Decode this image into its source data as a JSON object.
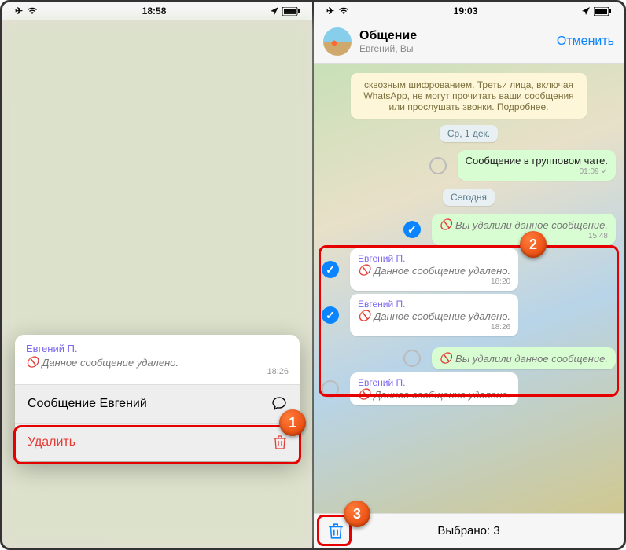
{
  "left": {
    "status": {
      "time": "18:58"
    },
    "bubble": {
      "sender": "Евгений П.",
      "text": "Данное сообщение удалено.",
      "time": "18:26"
    },
    "menu": {
      "reply": "Сообщение Евгений",
      "delete": "Удалить"
    },
    "badge": "1"
  },
  "right": {
    "status": {
      "time": "19:03"
    },
    "header": {
      "title": "Общение",
      "subtitle": "Евгений, Вы",
      "cancel": "Отменить"
    },
    "encryption_note": "сквозным шифрованием. Третьи лица, включая WhatsApp, не могут прочитать ваши сообщения или прослушать звонки. Подробнее.",
    "date1": "Ср, 1 дек.",
    "date2": "Сегодня",
    "msg_out1": {
      "text": "Сообщение в групповом чате.",
      "time": "01:09"
    },
    "sel": [
      {
        "sender": "",
        "text": "Вы удалили данное сообщение.",
        "time": "15:48",
        "out": true
      },
      {
        "sender": "Евгений П.",
        "text": "Данное сообщение удалено.",
        "time": "18:20",
        "out": false
      },
      {
        "sender": "Евгений П.",
        "text": "Данное сообщение удалено.",
        "time": "18:26",
        "out": false
      }
    ],
    "msg_out2": {
      "text": "Вы удалили данное сообщение.",
      "time": ""
    },
    "msg_in2": {
      "sender": "Евгений П.",
      "text": "Данное сообщение удалено.",
      "time": ""
    },
    "footer": "Выбрано: 3",
    "badge2": "2",
    "badge3": "3"
  }
}
